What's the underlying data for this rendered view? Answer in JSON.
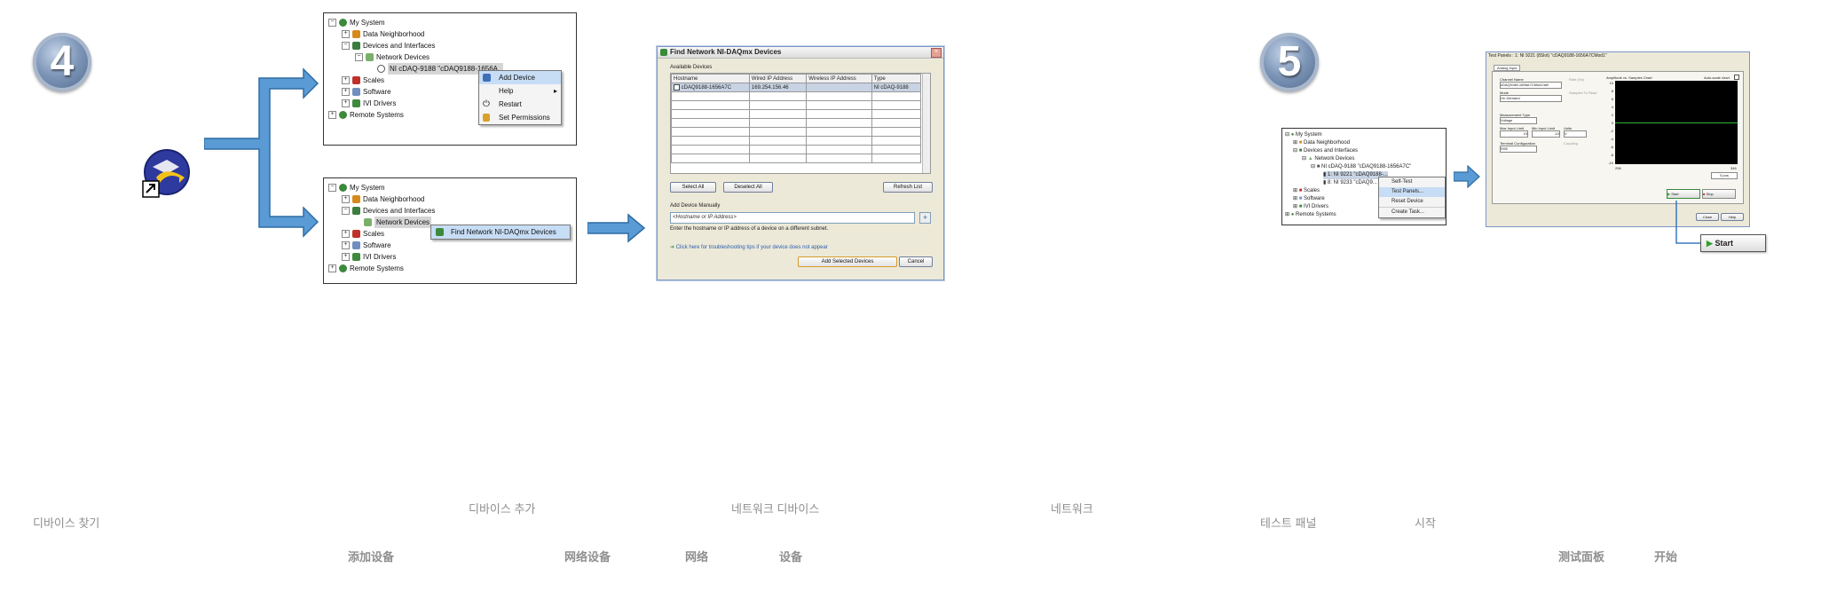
{
  "steps": {
    "a": "4",
    "b": "5"
  },
  "tree": {
    "my_system": "My System",
    "data_neighborhood": "Data Neighborhood",
    "devices_interfaces": "Devices and Interfaces",
    "network_devices": "Network Devices",
    "device_node": "NI cDAQ-9188 \"cDAQ9188-1656A..",
    "scales": "Scales",
    "software": "Software",
    "ivi": "IVI Drivers",
    "remote": "Remote Systems"
  },
  "context_menu_1": {
    "add_device": "Add Device",
    "help": "Help",
    "restart": "Restart",
    "permissions": "Set Permissions"
  },
  "context_menu_2": {
    "find": "Find Network NI-DAQmx Devices"
  },
  "find_dialog": {
    "title": "Find Network NI-DAQmx Devices",
    "available": "Available Devices",
    "columns": [
      "Hostname",
      "Wired IP Address",
      "Wireless IP Address",
      "Type"
    ],
    "row": [
      "cDAQ9188-1656A7C",
      "169.254.156.46",
      "",
      "NI cDAQ-9188"
    ],
    "select_all": "Select All",
    "deselect_all": "Deselect All",
    "refresh": "Refresh List",
    "add_manually": "Add Device Manually",
    "host_placeholder": "<Hostname or IP Address>",
    "hint": "Enter the hostname or IP address of a device on a different subnet.",
    "help_link": "Click here for troubleshooting tips if your device does not appear",
    "add_selected": "Add Selected Devices",
    "cancel": "Cancel"
  },
  "tree5": {
    "my_system": "My System",
    "data_neighborhood": "Data Neighborhood",
    "devices_interfaces": "Devices and Interfaces",
    "network_devices": "Network Devices",
    "chassis": "NI cDAQ-9188 \"cDAQ9188-1656A7C\"",
    "module1": "1: NI 9221 \"cDAQ9188-...",
    "module2": "8: NI 9233 \"cDAQ9...",
    "scales": "Scales",
    "software": "Software",
    "ivi": "IVI Drivers",
    "remote": "Remote Systems"
  },
  "context_menu_5": {
    "self_test": "Self-Test",
    "test_panels": "Test Panels...",
    "reset": "Reset Device",
    "create_task": "Create Task..."
  },
  "test_panel": {
    "title": "Test Panels : 1: NI 9221 (8Slot) \"cDAQ9188-1656A7CMod1\"",
    "tab": "Analog Input",
    "channel_name_label": "Channel Name",
    "channel_name": "cDAQ9188-1656A7CMod1/ai0",
    "mode_label": "Mode",
    "mode": "On Demand",
    "rate_label": "Rate (Hz)",
    "samples_label": "Samples To Read",
    "meas_type_label": "Measurement Type",
    "meas_type": "Voltage",
    "max_label": "Max Input Limit",
    "min_label": "Min Input Limit",
    "units_label": "Units",
    "units": "V",
    "max": "10",
    "min": "-10",
    "terminal_label": "Terminal Configuration",
    "terminal": "RSE",
    "coupling_label": "Coupling",
    "graph_label": "Amplitude vs. Samples Chart",
    "autoscale_label": "Auto-scale chart",
    "y_ticks": [
      "10",
      "8",
      "6",
      "4",
      "2",
      "0",
      "-2",
      "-4",
      "-6",
      "-8",
      "-10"
    ],
    "x_ticks": [
      "296",
      "346"
    ],
    "value": "0 pos",
    "start": "Start",
    "stop": "Stop",
    "close": "Close",
    "help": "Help"
  },
  "start_callout": "Start",
  "captions_kr": {
    "find_device": "디바이스 찾기",
    "add_device": "디바이스 추가",
    "network_device": "네트워크 디바이스",
    "network": "네트워크",
    "test_panel": "테스트 패널",
    "start": "시작"
  },
  "captions_cn": {
    "add_device": "添加设备",
    "network_device": "网络设备",
    "network": "网络",
    "device": "设备",
    "test_panel": "测试面板",
    "start": "开始"
  },
  "colors": {
    "arrow": "#5b9bd5",
    "arrow_edge": "#2e6ca4",
    "chart_bg": "#000000",
    "trace": "#2fb52f"
  }
}
